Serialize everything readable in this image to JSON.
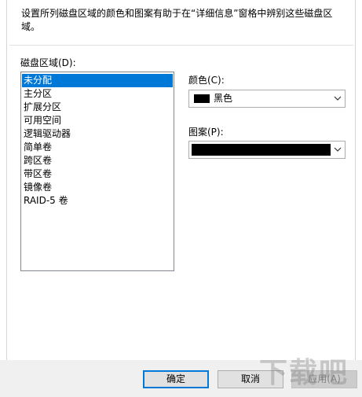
{
  "description": "设置所列磁盘区域的颜色和图案有助于在“详细信息”窗格中辨别这些磁盘区域。",
  "disk_region": {
    "label": "磁盘区域(D):",
    "items": [
      "未分配",
      "主分区",
      "扩展分区",
      "可用空间",
      "逻辑驱动器",
      "简单卷",
      "跨区卷",
      "带区卷",
      "镜像卷",
      "RAID-5 卷"
    ],
    "selected_index": 0
  },
  "color": {
    "label": "颜色(C):",
    "value": "黑色",
    "swatch": "#000000"
  },
  "pattern": {
    "label": "图案(P):",
    "swatch": "#000000"
  },
  "buttons": {
    "ok": "确定",
    "cancel": "取消",
    "apply": "应用(A)"
  },
  "watermark": {
    "text": "下载吧"
  },
  "colors": {
    "selection": "#0078d7",
    "default_button_border": "#0078d7"
  }
}
